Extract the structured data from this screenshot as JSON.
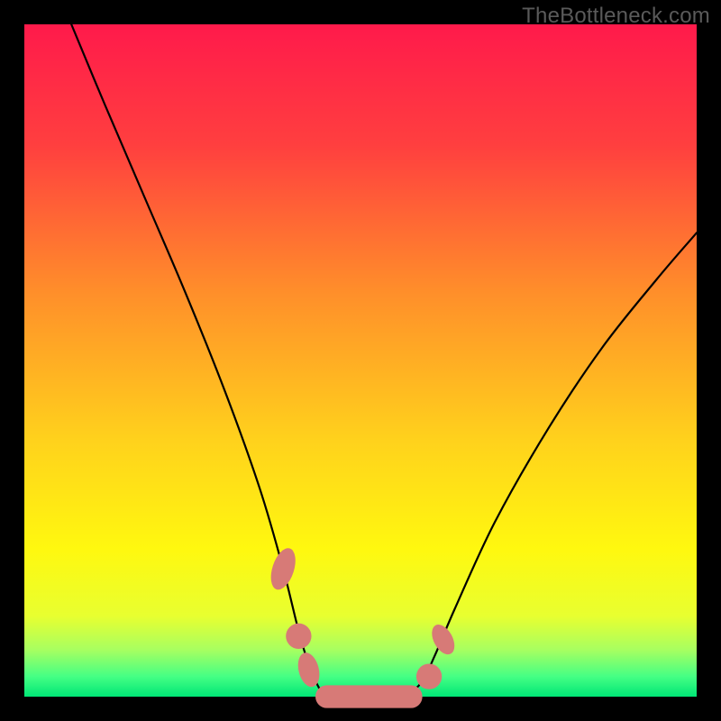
{
  "watermark": "TheBottleneck.com",
  "colors": {
    "frame": "#000000",
    "curve": "#000000",
    "marker": "#d77a77",
    "watermark": "#5a5a5a"
  },
  "chart_data": {
    "type": "line",
    "title": "",
    "xlabel": "",
    "ylabel": "",
    "xlim": [
      0,
      100
    ],
    "ylim": [
      0,
      100
    ],
    "gradient_stops": [
      {
        "pos": 0.0,
        "color": "#ff1a4b"
      },
      {
        "pos": 0.18,
        "color": "#ff3f3f"
      },
      {
        "pos": 0.4,
        "color": "#ff8f2a"
      },
      {
        "pos": 0.62,
        "color": "#ffd21c"
      },
      {
        "pos": 0.78,
        "color": "#fff80f"
      },
      {
        "pos": 0.88,
        "color": "#e8ff30"
      },
      {
        "pos": 0.93,
        "color": "#a8ff60"
      },
      {
        "pos": 0.97,
        "color": "#45ff84"
      },
      {
        "pos": 1.0,
        "color": "#00e676"
      }
    ],
    "series": [
      {
        "name": "bottleneck-curve",
        "x": [
          7,
          12,
          18,
          24,
          30,
          35,
          38.5,
          41,
          43,
          45,
          48,
          52,
          56,
          59,
          61,
          64,
          70,
          78,
          86,
          94,
          100
        ],
        "y": [
          100,
          88,
          74,
          60,
          45,
          31,
          19,
          9,
          3,
          0,
          0,
          0,
          0,
          2,
          6,
          13,
          26,
          40,
          52,
          62,
          69
        ]
      }
    ],
    "markers": [
      {
        "shape": "oval",
        "cx": 38.5,
        "cy": 19.0,
        "rx": 1.6,
        "ry": 3.2,
        "rot": 18
      },
      {
        "shape": "circle",
        "cx": 40.8,
        "cy": 9.0,
        "r": 1.9
      },
      {
        "shape": "oval",
        "cx": 42.3,
        "cy": 4.0,
        "rx": 1.5,
        "ry": 2.6,
        "rot": -14
      },
      {
        "shape": "capsule",
        "x1": 45.0,
        "x2": 57.5,
        "cy": 0.0,
        "r": 1.7
      },
      {
        "shape": "circle",
        "cx": 60.2,
        "cy": 3.0,
        "r": 1.9
      },
      {
        "shape": "oval",
        "cx": 62.3,
        "cy": 8.5,
        "rx": 1.4,
        "ry": 2.4,
        "rot": -28
      }
    ]
  }
}
